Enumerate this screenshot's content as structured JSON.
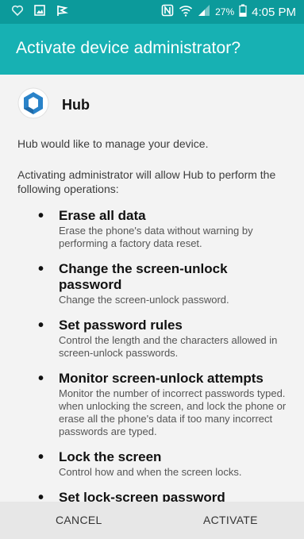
{
  "status_bar": {
    "battery_percent": "27%",
    "time": "4:05 PM",
    "icons": [
      "heart-icon",
      "image-icon",
      "flag-icon",
      "nfc-icon",
      "wifi-icon",
      "signal-icon",
      "battery-icon"
    ]
  },
  "dialog": {
    "title": "Activate device administrator?",
    "app_name": "Hub",
    "app_icon": "hub-logo-icon",
    "intro": "Hub would like to manage your device.",
    "lead": "Activating administrator will allow Hub to perform the following operations:",
    "operations": [
      {
        "title": "Erase all data",
        "description": "Erase the phone's data without warning by performing a factory data reset."
      },
      {
        "title": "Change the screen-unlock password",
        "description": "Change the screen-unlock password."
      },
      {
        "title": "Set password rules",
        "description": "Control the length and the characters allowed in screen-unlock passwords."
      },
      {
        "title": "Monitor screen-unlock attempts",
        "description": "Monitor the number of incorrect passwords typed. when unlocking the screen, and lock the phone or erase all the phone's data if too many incorrect passwords are typed."
      },
      {
        "title": "Lock the screen",
        "description": "Control how and when the screen locks."
      },
      {
        "title": "Set lock-screen password",
        "description": ""
      }
    ]
  },
  "buttons": {
    "cancel": "CANCEL",
    "activate": "ACTIVATE"
  },
  "colors": {
    "status_bar": "#0c9a9b",
    "app_bar": "#17b1b3",
    "background": "#f3f3f3",
    "footer": "#e7e7e7"
  }
}
